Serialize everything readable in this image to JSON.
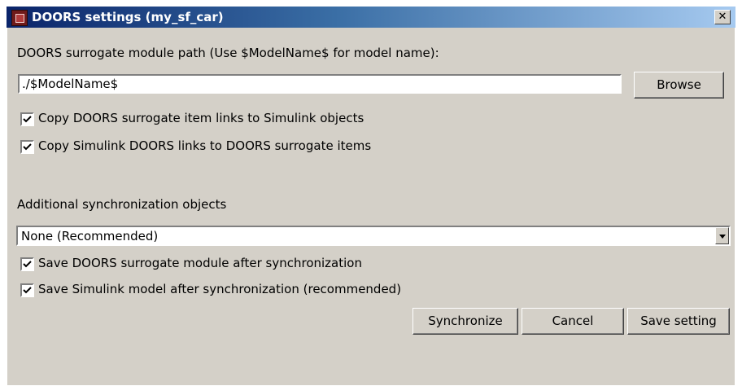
{
  "window": {
    "title": "DOORS settings (my_sf_car)"
  },
  "path": {
    "label": "DOORS surrogate module path (Use $ModelName$ for model name):",
    "value": "./$ModelName$",
    "browse_label": "Browse"
  },
  "options": [
    {
      "label": "Copy DOORS surrogate item links to Simulink objects",
      "checked": true
    },
    {
      "label": "Copy Simulink DOORS links to DOORS surrogate items",
      "checked": true
    }
  ],
  "sync_objects": {
    "label": "Additional synchronization objects",
    "selected": "None  (Recommended)"
  },
  "save_options": [
    {
      "label": "Save DOORS surrogate module after synchronization",
      "checked": true
    },
    {
      "label": "Save Simulink model after synchronization (recommended)",
      "checked": true
    }
  ],
  "buttons": {
    "synchronize": "Synchronize",
    "cancel": "Cancel",
    "save_setting": "Save setting"
  }
}
